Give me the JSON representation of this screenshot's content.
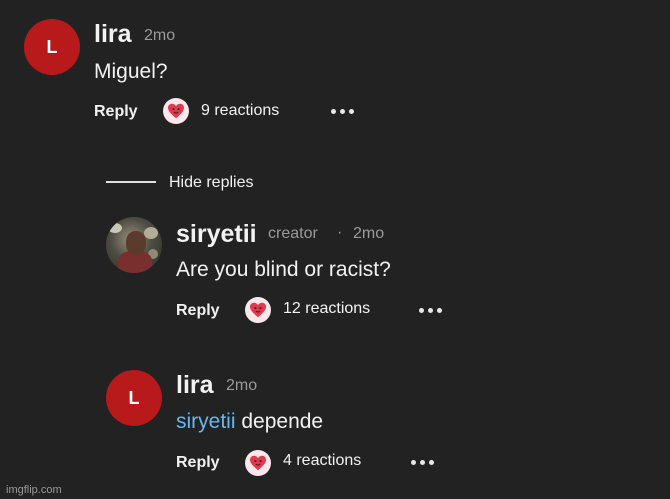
{
  "comments": [
    {
      "avatar_letter": "L",
      "username": "lira",
      "time": "2mo",
      "text": "Miguel?",
      "reply_label": "Reply",
      "reactions": "9 reactions"
    },
    {
      "username": "siryetii",
      "badge": "creator",
      "separator": "·",
      "time": "2mo",
      "text": "Are you blind or racist?",
      "reply_label": "Reply",
      "reactions": "12 reactions"
    },
    {
      "avatar_letter": "L",
      "username": "lira",
      "time": "2mo",
      "mention": "siryetii",
      "text": "depende",
      "reply_label": "Reply",
      "reactions": "4 reactions"
    }
  ],
  "hide_replies_label": "Hide replies",
  "watermark": "imgflip.com",
  "colors": {
    "background": "#222222",
    "avatar_red": "#b8191b",
    "mention_blue": "#6ab7ee",
    "heart_red": "#e0394f"
  },
  "icons": {
    "reaction": "heart-face-icon",
    "more": "more-dots-icon"
  }
}
